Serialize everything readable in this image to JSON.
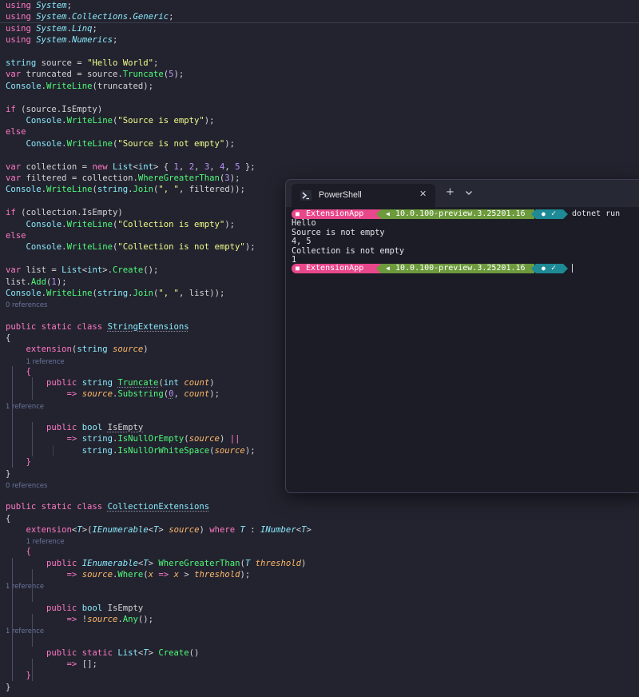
{
  "editor": {
    "lines": [
      [
        [
          "k",
          "using "
        ],
        [
          "ti",
          "System"
        ],
        [
          "",
          "; "
        ]
      ],
      [
        [
          "k",
          "using "
        ],
        [
          "ti",
          "System"
        ],
        [
          "",
          "."
        ],
        [
          "ti",
          "Collections"
        ],
        [
          "",
          "."
        ],
        [
          "ti",
          "Generic"
        ],
        [
          "",
          ";"
        ]
      ],
      [
        [
          "k",
          "using "
        ],
        [
          "ti",
          "System"
        ],
        [
          "",
          "."
        ],
        [
          "ti",
          "Linq"
        ],
        [
          "",
          ";"
        ]
      ],
      [
        [
          "k",
          "using "
        ],
        [
          "ti",
          "System"
        ],
        [
          "",
          "."
        ],
        [
          "ti",
          "Numerics"
        ],
        [
          "",
          ";"
        ]
      ],
      [],
      [
        [
          "t",
          "string"
        ],
        [
          "",
          " source = "
        ],
        [
          "s",
          "\"Hello World\""
        ],
        [
          "",
          ";"
        ]
      ],
      [
        [
          "k",
          "var"
        ],
        [
          "",
          " truncated = source."
        ],
        [
          "m",
          "Truncate"
        ],
        [
          "",
          "("
        ],
        [
          "n",
          "5"
        ],
        [
          "",
          ");"
        ]
      ],
      [
        [
          "t",
          "Console"
        ],
        [
          "",
          "."
        ],
        [
          "m",
          "WriteLine"
        ],
        [
          "",
          "(truncated);"
        ]
      ],
      [],
      [
        [
          "k",
          "if"
        ],
        [
          "",
          " (source.IsEmpty)"
        ]
      ],
      [
        [
          "",
          "    "
        ],
        [
          "t",
          "Console"
        ],
        [
          "",
          "."
        ],
        [
          "m",
          "WriteLine"
        ],
        [
          "",
          "("
        ],
        [
          "s",
          "\"Source is empty\""
        ],
        [
          "",
          ");"
        ]
      ],
      [
        [
          "k",
          "else"
        ]
      ],
      [
        [
          "",
          "    "
        ],
        [
          "t",
          "Console"
        ],
        [
          "",
          "."
        ],
        [
          "m",
          "WriteLine"
        ],
        [
          "",
          "("
        ],
        [
          "s",
          "\"Source is not empty\""
        ],
        [
          "",
          ");"
        ]
      ],
      [],
      [
        [
          "k",
          "var"
        ],
        [
          "",
          " collection = "
        ],
        [
          "k",
          "new"
        ],
        [
          "",
          " "
        ],
        [
          "t",
          "List"
        ],
        [
          "",
          "<"
        ],
        [
          "t",
          "int"
        ],
        [
          "",
          "> { "
        ],
        [
          "n",
          "1"
        ],
        [
          "",
          ", "
        ],
        [
          "n",
          "2"
        ],
        [
          "",
          ", "
        ],
        [
          "n",
          "3"
        ],
        [
          "",
          ", "
        ],
        [
          "n",
          "4"
        ],
        [
          "",
          ", "
        ],
        [
          "n",
          "5"
        ],
        [
          "",
          " };"
        ]
      ],
      [
        [
          "k",
          "var"
        ],
        [
          "",
          " filtered = collection."
        ],
        [
          "m",
          "WhereGreaterThan"
        ],
        [
          "",
          "("
        ],
        [
          "n",
          "3"
        ],
        [
          "",
          ");"
        ]
      ],
      [
        [
          "t",
          "Console"
        ],
        [
          "",
          "."
        ],
        [
          "m",
          "WriteLine"
        ],
        [
          "",
          "("
        ],
        [
          "t",
          "string"
        ],
        [
          "",
          "."
        ],
        [
          "m",
          "Join"
        ],
        [
          "",
          "("
        ],
        [
          "s",
          "\", \""
        ],
        [
          "",
          ", filtered));"
        ]
      ],
      [],
      [
        [
          "k",
          "if"
        ],
        [
          "",
          " (collection.IsEmpty)"
        ]
      ],
      [
        [
          "",
          "    "
        ],
        [
          "t",
          "Console"
        ],
        [
          "",
          "."
        ],
        [
          "m",
          "WriteLine"
        ],
        [
          "",
          "("
        ],
        [
          "s",
          "\"Collection is empty\""
        ],
        [
          "",
          ");"
        ]
      ],
      [
        [
          "k",
          "else"
        ]
      ],
      [
        [
          "",
          "    "
        ],
        [
          "t",
          "Console"
        ],
        [
          "",
          "."
        ],
        [
          "m",
          "WriteLine"
        ],
        [
          "",
          "("
        ],
        [
          "s",
          "\"Collection is not empty\""
        ],
        [
          "",
          ");"
        ]
      ],
      [],
      [
        [
          "k",
          "var"
        ],
        [
          "",
          " list = "
        ],
        [
          "t",
          "List"
        ],
        [
          "",
          "<"
        ],
        [
          "t",
          "int"
        ],
        [
          "",
          ">."
        ],
        [
          "m",
          "Create"
        ],
        [
          "",
          "();"
        ]
      ],
      [
        [
          "",
          "list."
        ],
        [
          "m",
          "Add"
        ],
        [
          "",
          "("
        ],
        [
          "n",
          "1"
        ],
        [
          "",
          ");"
        ]
      ],
      [
        [
          "t",
          "Console"
        ],
        [
          "",
          "."
        ],
        [
          "m",
          "WriteLine"
        ],
        [
          "",
          "("
        ],
        [
          "t",
          "string"
        ],
        [
          "",
          "."
        ],
        [
          "m",
          "Join"
        ],
        [
          "",
          "("
        ],
        [
          "s",
          "\", \""
        ],
        [
          "",
          ", list));"
        ]
      ],
      [],
      [
        [
          "k",
          "public static class "
        ],
        [
          "t squig",
          "StringExtensions"
        ]
      ],
      [
        [
          "",
          "{"
        ]
      ],
      [
        [
          "",
          "    "
        ],
        [
          "k",
          "extension"
        ],
        [
          "",
          "("
        ],
        [
          "t",
          "string"
        ],
        [
          "",
          " "
        ],
        [
          "p",
          "source"
        ],
        [
          "",
          ")"
        ]
      ],
      [
        [
          "",
          "    "
        ],
        [
          "br",
          "{"
        ]
      ],
      [
        [
          "",
          "        "
        ],
        [
          "k",
          "public "
        ],
        [
          "t",
          "string"
        ],
        [
          "",
          " "
        ],
        [
          "m squig",
          "Truncate"
        ],
        [
          "",
          "("
        ],
        [
          "t",
          "int"
        ],
        [
          "",
          " "
        ],
        [
          "p",
          "count"
        ],
        [
          "",
          ")"
        ]
      ],
      [
        [
          "",
          "            "
        ],
        [
          "k",
          "=> "
        ],
        [
          "p",
          "source"
        ],
        [
          "",
          "."
        ],
        [
          "m",
          "Substring"
        ],
        [
          "",
          "("
        ],
        [
          "n squig",
          "0"
        ],
        [
          "",
          ", "
        ],
        [
          "p",
          "count"
        ],
        [
          "",
          ");"
        ]
      ],
      [],
      [
        [
          "",
          "        "
        ],
        [
          "k",
          "public "
        ],
        [
          "t",
          "bool"
        ],
        [
          "",
          " "
        ],
        [
          "squig",
          "IsEmpty"
        ]
      ],
      [
        [
          "",
          "            "
        ],
        [
          "k",
          "=> "
        ],
        [
          "t",
          "string"
        ],
        [
          "",
          "."
        ],
        [
          "m",
          "IsNullOrEmpty"
        ],
        [
          "",
          "("
        ],
        [
          "p",
          "source"
        ],
        [
          "",
          ") "
        ],
        [
          "k",
          "||"
        ]
      ],
      [
        [
          "",
          "               "
        ],
        [
          "t",
          "string"
        ],
        [
          "",
          "."
        ],
        [
          "m",
          "IsNullOrWhiteSpace"
        ],
        [
          "",
          "("
        ],
        [
          "p",
          "source"
        ],
        [
          "",
          ");"
        ]
      ],
      [
        [
          "",
          "    "
        ],
        [
          "br",
          "}"
        ]
      ],
      [
        [
          "",
          "}"
        ]
      ],
      [],
      [
        [
          "k",
          "public static class "
        ],
        [
          "t squig",
          "CollectionExtensions"
        ]
      ],
      [
        [
          "",
          "{"
        ]
      ],
      [
        [
          "",
          "    "
        ],
        [
          "k",
          "extension"
        ],
        [
          "",
          "<"
        ],
        [
          "ti",
          "T"
        ],
        [
          "",
          ">("
        ],
        [
          "ti",
          "IEnumerable"
        ],
        [
          "",
          "<"
        ],
        [
          "ti",
          "T"
        ],
        [
          "",
          "> "
        ],
        [
          "p",
          "source"
        ],
        [
          "",
          ") "
        ],
        [
          "k",
          "where "
        ],
        [
          "ti",
          "T"
        ],
        [
          "",
          " : "
        ],
        [
          "ti",
          "INumber"
        ],
        [
          "",
          "<"
        ],
        [
          "ti",
          "T"
        ],
        [
          "",
          ">"
        ]
      ],
      [
        [
          "",
          "    "
        ],
        [
          "br",
          "{"
        ]
      ],
      [
        [
          "",
          "        "
        ],
        [
          "k",
          "public "
        ],
        [
          "ti",
          "IEnumerable"
        ],
        [
          "",
          "<"
        ],
        [
          "ti",
          "T"
        ],
        [
          "",
          "> "
        ],
        [
          "m",
          "WhereGreaterThan"
        ],
        [
          "",
          "("
        ],
        [
          "ti",
          "T"
        ],
        [
          "",
          " "
        ],
        [
          "p",
          "threshold"
        ],
        [
          "",
          ")"
        ]
      ],
      [
        [
          "",
          "            "
        ],
        [
          "k",
          "=> "
        ],
        [
          "p",
          "source"
        ],
        [
          "",
          "."
        ],
        [
          "m",
          "Where"
        ],
        [
          "",
          "("
        ],
        [
          "p",
          "x"
        ],
        [
          "",
          " "
        ],
        [
          "k",
          "=>"
        ],
        [
          "",
          " "
        ],
        [
          "p",
          "x"
        ],
        [
          "",
          " > "
        ],
        [
          "p",
          "threshold"
        ],
        [
          "",
          ");"
        ]
      ],
      [],
      [
        [
          "",
          "        "
        ],
        [
          "k",
          "public "
        ],
        [
          "t",
          "bool"
        ],
        [
          "",
          " IsEmpty"
        ]
      ],
      [
        [
          "",
          "            "
        ],
        [
          "k",
          "=> "
        ],
        [
          "",
          "!"
        ],
        [
          "p",
          "source"
        ],
        [
          "",
          "."
        ],
        [
          "m",
          "Any"
        ],
        [
          "",
          "();"
        ]
      ],
      [],
      [
        [
          "",
          "        "
        ],
        [
          "k",
          "public static "
        ],
        [
          "t",
          "List"
        ],
        [
          "",
          "<"
        ],
        [
          "ti",
          "T"
        ],
        [
          "",
          "> "
        ],
        [
          "m",
          "Create"
        ],
        [
          "",
          "()"
        ]
      ],
      [
        [
          "",
          "            "
        ],
        [
          "k",
          "=> "
        ],
        [
          "",
          "[];"
        ]
      ],
      [
        [
          "",
          "    "
        ],
        [
          "br",
          "}"
        ]
      ],
      [
        [
          "",
          "}"
        ]
      ]
    ],
    "codelens": [
      {
        "after_line": 26,
        "text": "0 references"
      },
      {
        "after_line": 30,
        "text": "1 reference"
      },
      {
        "after_line": 33,
        "text": "1 reference"
      },
      {
        "after_line": 39,
        "text": "0 references"
      },
      {
        "after_line": 43,
        "text": "1 reference"
      },
      {
        "after_line": 46,
        "text": "1 reference"
      },
      {
        "after_line": 49,
        "text": "1 reference"
      }
    ]
  },
  "terminal": {
    "tab_title": "PowerShell",
    "close_glyph": "✕",
    "new_tab_glyph": "+",
    "prompt": {
      "folder": "ExtensionApp",
      "sdk": "10.0.100-preview.3.25201.16",
      "status": "✓"
    },
    "command": "dotnet run",
    "output": [
      "Hello",
      "Source is not empty",
      "4, 5",
      "Collection is not empty",
      "1"
    ],
    "colors": {
      "folder_bg": "#e8478b",
      "sdk_bg": "#6c9a3c",
      "status_bg": "#1d8a96"
    }
  }
}
